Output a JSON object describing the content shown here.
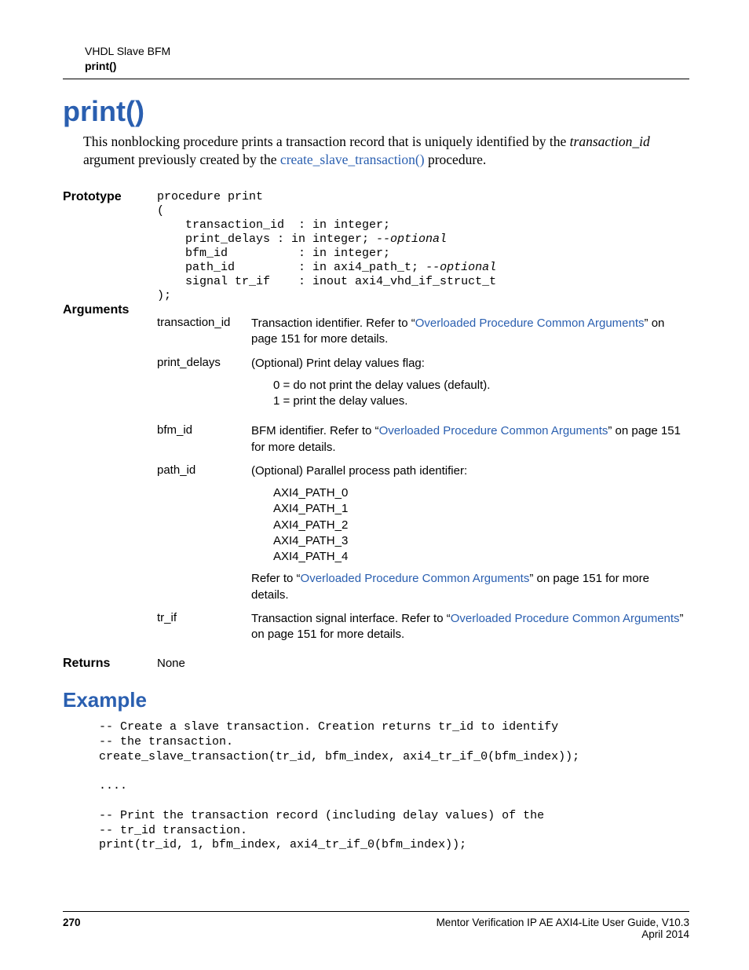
{
  "header": {
    "top": "VHDL Slave BFM",
    "sub": "print()"
  },
  "title": "print()",
  "intro": {
    "pre": "This nonblocking procedure prints a transaction record that is uniquely identified by the ",
    "italic": "transaction_id",
    "mid": " argument previously created by the ",
    "link": "create_slave_transaction()",
    "post": " procedure."
  },
  "prototype": {
    "label": "Prototype",
    "l1": "procedure print",
    "l2": "(",
    "l3": "    transaction_id  : in integer;",
    "l4a": "    print_delays : in integer; ",
    "l4b": "--optional",
    "l5": "    bfm_id          : in integer;",
    "l6a": "    path_id         : in axi4_path_t; ",
    "l6b": "--optional",
    "l7": "    signal tr_if    : inout axi4_vhd_if_struct_t",
    "l8": ");"
  },
  "arguments": {
    "label": "Arguments",
    "items": [
      {
        "name": "transaction_id",
        "desc_pre": "Transaction identifier. Refer to “",
        "desc_link1": "Overloaded Procedure Common Arguments",
        "desc_post1": "” on page 151 for more details."
      },
      {
        "name": "print_delays",
        "desc_plain": "(Optional) Print delay values flag:",
        "sub1": "0 = do not print the delay values (default).",
        "sub2": "1 = print the delay values."
      },
      {
        "name": "bfm_id",
        "desc_pre": "BFM identifier. Refer to “",
        "desc_link1": "Overloaded Procedure Common Arguments",
        "desc_post1": "” on page 151 for more details."
      },
      {
        "name": "path_id",
        "desc_plain": "(Optional) Parallel process path identifier:",
        "sub1": "AXI4_PATH_0",
        "sub2": "AXI4_PATH_1",
        "sub3": "AXI4_PATH_2",
        "sub4": "AXI4_PATH_3",
        "sub5": "AXI4_PATH_4",
        "after_pre": "Refer to “",
        "after_link": "Overloaded Procedure Common Arguments",
        "after_post": "” on page 151 for more details."
      },
      {
        "name": "tr_if",
        "desc_pre": "Transaction signal interface. Refer to “",
        "desc_link1": "Overloaded Procedure Common Arguments",
        "desc_post1": "” on page 151 for more details."
      }
    ]
  },
  "returns": {
    "label": "Returns",
    "value": "None"
  },
  "example": {
    "heading": "Example",
    "code": "-- Create a slave transaction. Creation returns tr_id to identify\n-- the transaction.\ncreate_slave_transaction(tr_id, bfm_index, axi4_tr_if_0(bfm_index));\n\n....\n\n-- Print the transaction record (including delay values) of the\n-- tr_id transaction.\nprint(tr_id, 1, bfm_index, axi4_tr_if_0(bfm_index));"
  },
  "footer": {
    "page": "270",
    "right1": "Mentor Verification IP AE AXI4-Lite User Guide, V10.3",
    "right2": "April 2014"
  }
}
